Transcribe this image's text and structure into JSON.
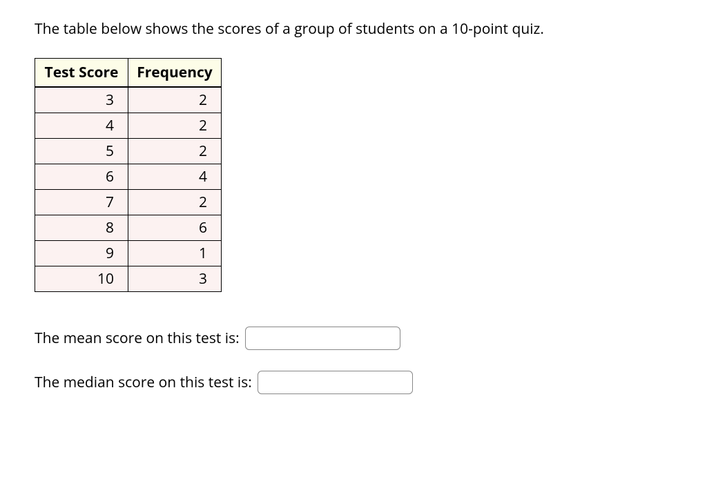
{
  "intro": "The table below shows the scores of a group of students on a 10-point quiz.",
  "table": {
    "headers": [
      "Test Score",
      "Frequency"
    ],
    "rows": [
      {
        "score": "3",
        "freq": "2"
      },
      {
        "score": "4",
        "freq": "2"
      },
      {
        "score": "5",
        "freq": "2"
      },
      {
        "score": "6",
        "freq": "4"
      },
      {
        "score": "7",
        "freq": "2"
      },
      {
        "score": "8",
        "freq": "6"
      },
      {
        "score": "9",
        "freq": "1"
      },
      {
        "score": "10",
        "freq": "3"
      }
    ]
  },
  "questions": {
    "mean": {
      "label": "The mean score on this test is:",
      "value": ""
    },
    "median": {
      "label": "The median score on this test is:",
      "value": ""
    }
  }
}
